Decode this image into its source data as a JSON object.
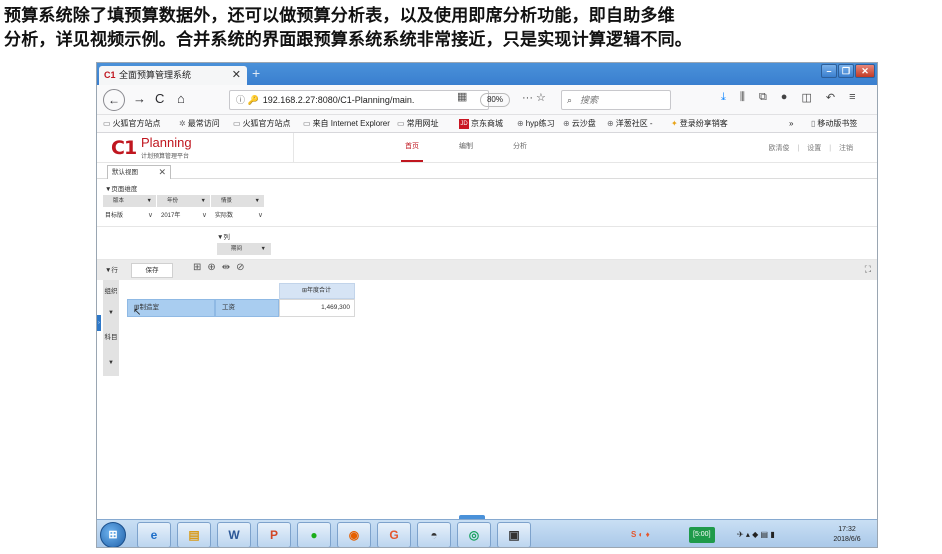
{
  "caption": {
    "line1": "预算系统除了填预算数据外，还可以做预算分析表，以及使用即席分析功能，即自助多维",
    "line2": "分析，详见视频示例。合并系统的界面跟预算系统系统非常接近，只是实现计算逻辑不同。"
  },
  "browser": {
    "tab_title": "全面预算管理系统",
    "tab_icon": "C1",
    "url": "192.168.2.27:8080/C1-Planning/main.",
    "zoom": "80%",
    "search_placeholder": "搜索",
    "bookmarks": [
      "火狐官方站点",
      "最常访问",
      "火狐官方站点",
      "来自 Internet Explorer",
      "常用网址",
      "京东商城",
      "hyp练习",
      "云沙盘",
      "洋葱社区 -",
      "登录纷享销客",
      "移动版书签"
    ],
    "jd_badge": "JD"
  },
  "app": {
    "logo_mark": "C1",
    "logo_name": "Planning",
    "logo_sub": "计划预算管理平台",
    "nav": [
      "首页",
      "编制",
      "分析"
    ],
    "user_links": [
      "欧清俊",
      "设置",
      "注销"
    ],
    "view_tab": "默认视图",
    "page_dim_title": "▼页面维度",
    "dims": [
      {
        "header": "版本",
        "value": "目标版"
      },
      {
        "header": "年份",
        "value": "2017年"
      },
      {
        "header": "情景",
        "value": "实际数"
      }
    ],
    "col_title": "▼列",
    "col_header": "期间",
    "row_label": "▼行",
    "save_label": "保存",
    "row_panel": {
      "org": "组织",
      "subject": "科目"
    },
    "grid": {
      "col_head": "⊞年度合计",
      "row_org": "⊞制造室",
      "row_subject": "工资",
      "row_value": "1,469,300"
    }
  },
  "taskbar": {
    "timer": "[5:00]",
    "time": "17:32",
    "date": "2018/6/6"
  }
}
